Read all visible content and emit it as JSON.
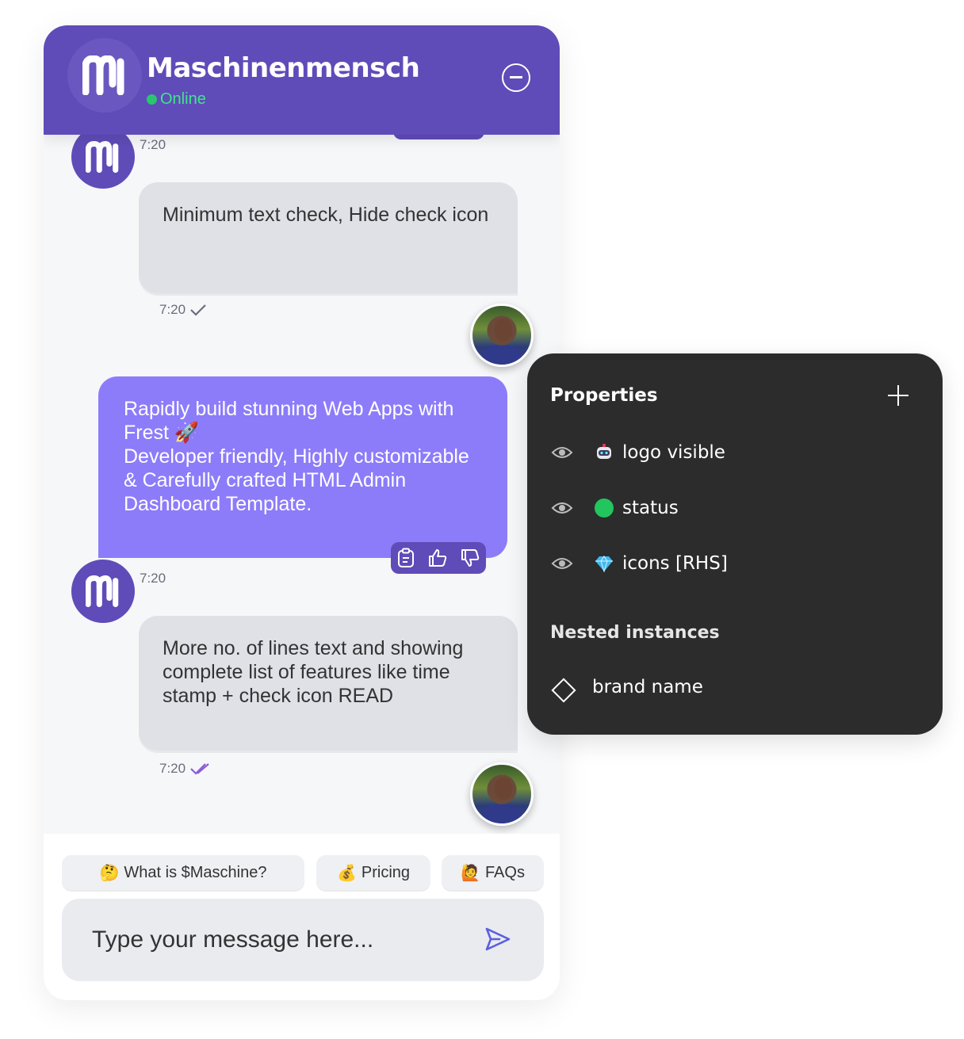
{
  "header": {
    "title": "Maschinenmensch",
    "status": "Online"
  },
  "messages": [
    {
      "time": "7:20"
    },
    {
      "text": "Minimum text check, Hide check icon",
      "time": "7:20"
    },
    {
      "text_line1": "Rapidly build stunning Web Apps with Frest 🚀",
      "text_line2": "Developer friendly, Highly customizable & Carefully crafted HTML Admin Dashboard Template.",
      "time": "7:20"
    },
    {
      "text": "More no. of lines text and showing complete list of features like time stamp + check icon READ",
      "time": "7:20"
    }
  ],
  "quick_replies": [
    {
      "emoji": "🤔",
      "label": "What is $Maschine?"
    },
    {
      "emoji": "💰",
      "label": "Pricing"
    },
    {
      "emoji": "🙋",
      "label": "FAQs"
    }
  ],
  "input": {
    "placeholder": "Type your message here..."
  },
  "properties_panel": {
    "title": "Properties",
    "items": [
      {
        "icon": "robot-icon",
        "label": "logo visible"
      },
      {
        "icon": "green-dot-icon",
        "label": "status"
      },
      {
        "icon": "gem-icon",
        "label": "icons [RHS]"
      }
    ],
    "nested_title": "Nested instances",
    "nested_items": [
      {
        "icon": "diamond-icon",
        "label": "brand name"
      }
    ]
  },
  "colors": {
    "brand": "#5f4cb8",
    "bubble_purple": "#8c7cf9",
    "online": "#28c76f",
    "panel_bg": "#2c2c2c"
  }
}
